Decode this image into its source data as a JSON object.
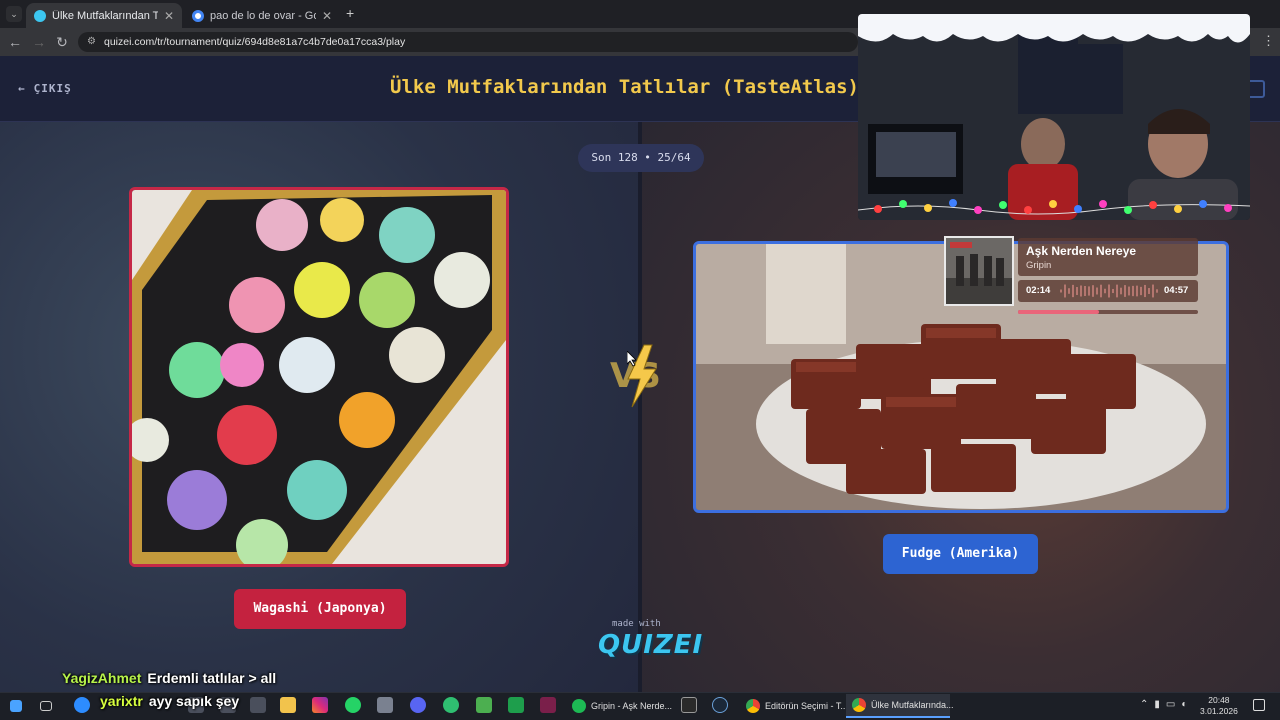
{
  "browser": {
    "tabs": [
      {
        "title": "Ülke Mutfaklarından Tatlılar (Ta",
        "active": true
      },
      {
        "title": "pao de lo de ovar - Google'da A",
        "active": false
      }
    ],
    "new_tab": "+",
    "url": "quizei.com/tr/tournament/quiz/694d8e81a7c4b7de0a17cca3/play"
  },
  "page": {
    "exit_label": "ÇIKIŞ",
    "quiz_title": "Ülke Mutfaklarından Tatlılar (TasteAtlas)",
    "round_info": "Son 128 • 25/64",
    "vs_label": "VS",
    "left_item": {
      "name": "Wagashi (Japonya)"
    },
    "right_item": {
      "name": "Fudge (Amerika)"
    },
    "made_with": "made with",
    "brand": "QUIZEI"
  },
  "music_widget": {
    "song": "Aşk Nerden Nereye",
    "artist": "Gripin",
    "current_time": "02:14",
    "total_time": "04:57",
    "progress": 0.45
  },
  "chat": [
    {
      "user": "YagizAhmet",
      "message": "Erdemli tatlılar > all"
    },
    {
      "user": "yarixtr",
      "message": "ayy sapık şey"
    }
  ],
  "taskbar": {
    "apps": [
      {
        "label": "Gripin - Aşk Nerde...",
        "icon": "spotify-icon"
      },
      {
        "label": "Editörün Seçimi - T...",
        "icon": "chrome-icon"
      },
      {
        "label": "Ülke Mutfaklarında...",
        "icon": "chrome-icon"
      }
    ],
    "time": "20:48",
    "date": "3.01.2026"
  },
  "colors": {
    "left_accent": "#c4223f",
    "right_accent": "#2d64d2",
    "title_color": "#f2c94c",
    "brand_color": "#3cc6f0"
  }
}
